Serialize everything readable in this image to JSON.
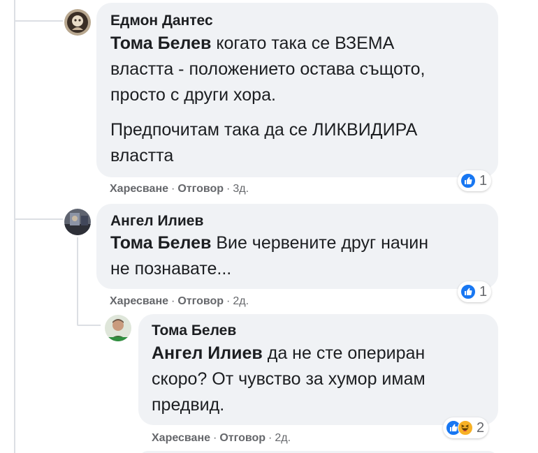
{
  "comments": [
    {
      "author": "Едмон Дантес",
      "mention": "Тома Белев",
      "line1_rest": "когато така се ВЗЕМА",
      "line2": "властта - положението остава същото,",
      "line3": "просто с други хора.",
      "para2_line1": "Предпочитам така да се ЛИКВИДИРА",
      "para2_line2": "властта",
      "reaction_count": "1",
      "like_label": "Харесване",
      "reply_label": "Отговор",
      "time": "3д."
    },
    {
      "author": "Ангел Илиев",
      "mention": "Тома Белев",
      "line1_rest": "Вие червените друг начин",
      "line2": "не познавате...",
      "reaction_count": "1",
      "like_label": "Харесване",
      "reply_label": "Отговор",
      "time": "2д."
    },
    {
      "author": "Тома Белев",
      "mention": "Ангел Илиев",
      "line1_rest": "да не сте опериран",
      "line2": "скоро? От чувство за хумор имам",
      "line3": "предвид.",
      "reaction_count": "2",
      "like_label": "Харесване",
      "reply_label": "Отговор",
      "time": "2д."
    }
  ],
  "colors": {
    "bubble": "#f0f2f5",
    "like": "#1877f2",
    "haha": "#f7b125",
    "meta": "#65676b"
  }
}
